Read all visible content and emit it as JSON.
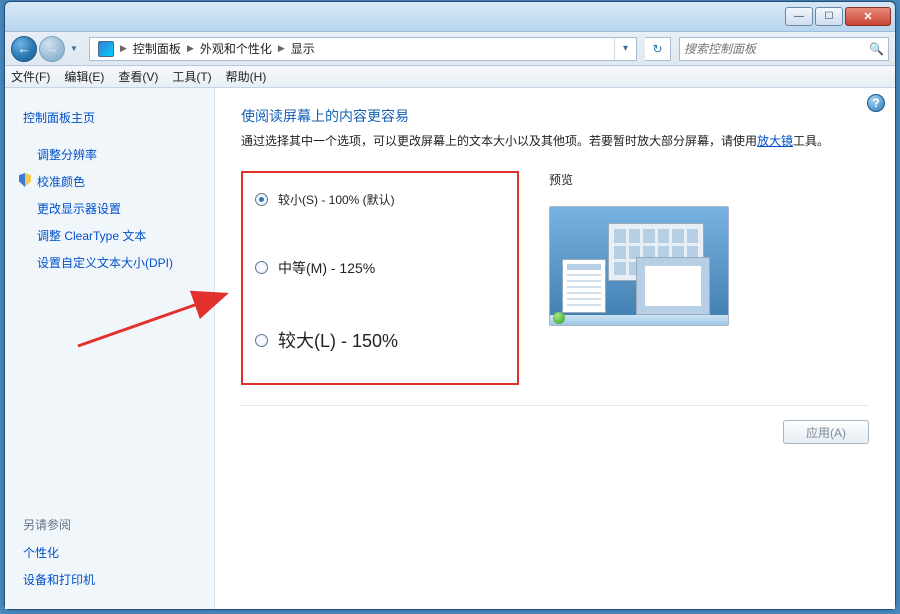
{
  "window_buttons": {
    "min": "—",
    "max": "☐",
    "close": "✕"
  },
  "breadcrumbs": [
    "控制面板",
    "外观和个性化",
    "显示"
  ],
  "refresh_glyph": "↻",
  "search": {
    "placeholder": "搜索控制面板",
    "glyph": "🔍"
  },
  "menubar": [
    "文件(F)",
    "编辑(E)",
    "查看(V)",
    "工具(T)",
    "帮助(H)"
  ],
  "sidebar": {
    "home": "控制面板主页",
    "links": [
      "调整分辨率",
      "校准颜色",
      "更改显示器设置",
      "调整 ClearType 文本",
      "设置自定义文本大小(DPI)"
    ],
    "see_also_head": "另请参阅",
    "see_also": [
      "个性化",
      "设备和打印机"
    ]
  },
  "main": {
    "title": "使阅读屏幕上的内容更容易",
    "sub_before": "通过选择其中一个选项，可以更改屏幕上的文本大小以及其他项。若要暂时放大部分屏幕，请使用",
    "sub_link": "放大镜",
    "sub_after": "工具。",
    "preview_label": "预览",
    "options": [
      {
        "label": "较小(S) - 100% (默认)",
        "checked": true
      },
      {
        "label": "中等(M) - 125%",
        "checked": false
      },
      {
        "label": "较大(L) - 150%",
        "checked": false
      }
    ],
    "apply": "应用(A)"
  },
  "help_glyph": "?"
}
